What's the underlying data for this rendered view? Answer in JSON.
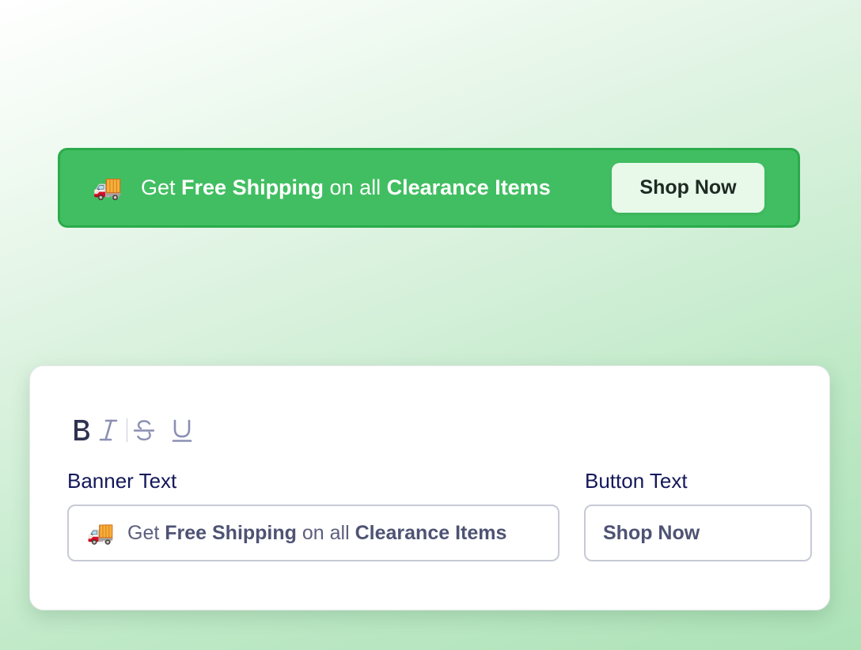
{
  "banner": {
    "icon": "delivery-truck-icon",
    "text_parts": {
      "p1": "Get ",
      "b1": "Free Shipping",
      "p2": " on all ",
      "b2": "Clearance Items"
    },
    "button_label": "Shop Now",
    "colors": {
      "background": "#41be61",
      "border": "#2bab4c",
      "button_background": "#e8f9ea"
    }
  },
  "editor": {
    "toolbar": {
      "bold_icon": "bold-icon",
      "italic_icon": "italic-icon",
      "strikethrough_icon": "strikethrough-icon",
      "underline_icon": "underline-icon"
    },
    "banner_text_label": "Banner Text",
    "banner_text_value": {
      "p1": "Get ",
      "b1": "Free Shipping",
      "p2": " on all ",
      "b2": "Clearance Items"
    },
    "button_text_label": "Button Text",
    "button_text_value": "Shop Now"
  }
}
